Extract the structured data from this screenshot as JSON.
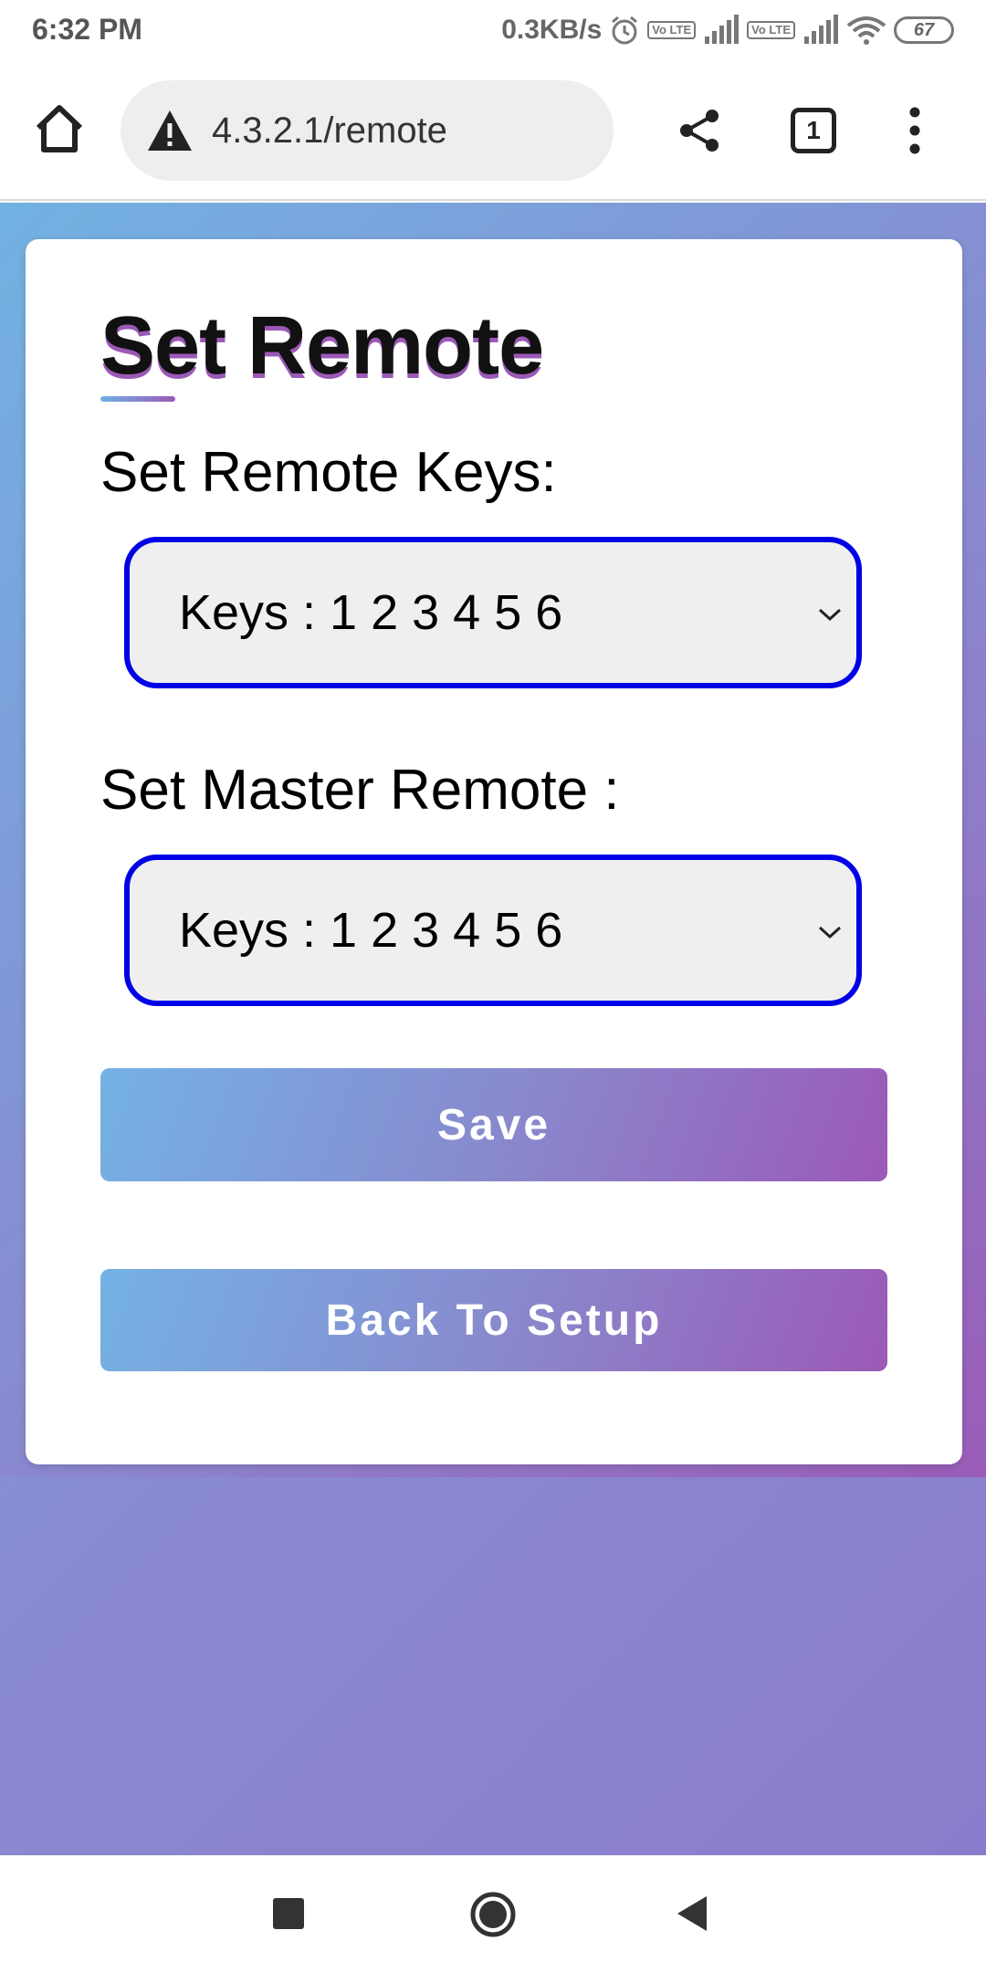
{
  "status_bar": {
    "time": "6:32 PM",
    "net_speed": "0.3KB/s",
    "volte_label": "Vo LTE",
    "battery": "67"
  },
  "browser": {
    "url": "4.3.2.1/remote",
    "tab_count": "1",
    "icons": [
      "home-icon",
      "warning-icon",
      "share-icon",
      "tabs-icon",
      "more-vert-icon"
    ]
  },
  "page": {
    "title": "Set Remote",
    "remote_keys_label": "Set Remote Keys:",
    "remote_keys_value": "Keys : 1 2 3 4 5 6",
    "master_remote_label": "Set Master Remote :",
    "master_remote_value": "Keys : 1 2 3 4 5 6",
    "save_label": "Save",
    "back_label": "Back To Setup"
  },
  "colors": {
    "select_border": "#0000e6",
    "gradient_start": "#74b2e4",
    "gradient_end": "#9b59b6"
  },
  "nav": {
    "icons": [
      "recents-icon",
      "home-circle-icon",
      "back-triangle-icon"
    ]
  }
}
